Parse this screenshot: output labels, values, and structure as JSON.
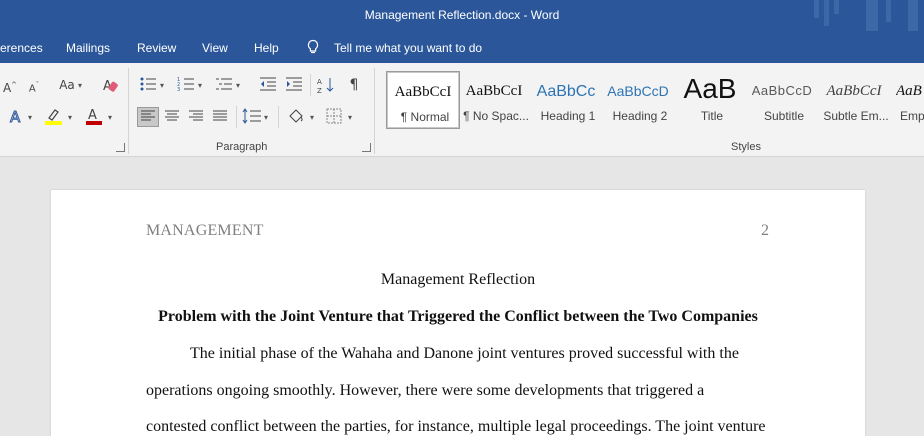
{
  "window": {
    "title": "Management Reflection.docx  -  Word"
  },
  "menu": {
    "tabs": [
      "erences",
      "Mailings",
      "Review",
      "View",
      "Help"
    ],
    "tell_me": "Tell me what you want to do"
  },
  "ribbon": {
    "paragraph_label": "Paragraph",
    "styles_label": "Styles",
    "styles": [
      {
        "sample": "AaBbCcI",
        "name": "¶ Normal"
      },
      {
        "sample": "AaBbCcI",
        "name": "¶ No Spac..."
      },
      {
        "sample": "AaBbCc",
        "name": "Heading 1"
      },
      {
        "sample": "AaBbCcD",
        "name": "Heading 2"
      },
      {
        "sample": "AaB",
        "name": "Title"
      },
      {
        "sample": "AaBbCcD",
        "name": "Subtitle"
      },
      {
        "sample": "AaBbCcI",
        "name": "Subtle Em..."
      },
      {
        "sample": "AaB",
        "name": "Emp"
      }
    ],
    "colors": {
      "highlight": "#ffff00",
      "font_color": "#c00000",
      "text_effects": "#2b579a"
    }
  },
  "document": {
    "header_text": "MANAGEMENT",
    "page_number": "2",
    "title": "Management Reflection",
    "heading": "Problem with the Joint Venture that Triggered the Conflict between the Two Companies",
    "paragraph_lines": [
      "The initial phase of the Wahaha and Danone joint ventures proved successful with the",
      "operations ongoing smoothly. However, there were some developments that triggered a",
      "contested conflict between the parties, for instance, multiple legal proceedings. The joint venture"
    ]
  },
  "colors": {
    "accent": "#2b579a",
    "ribbon_bg": "#f3f3f3",
    "doc_bg": "#e6e6e6"
  }
}
